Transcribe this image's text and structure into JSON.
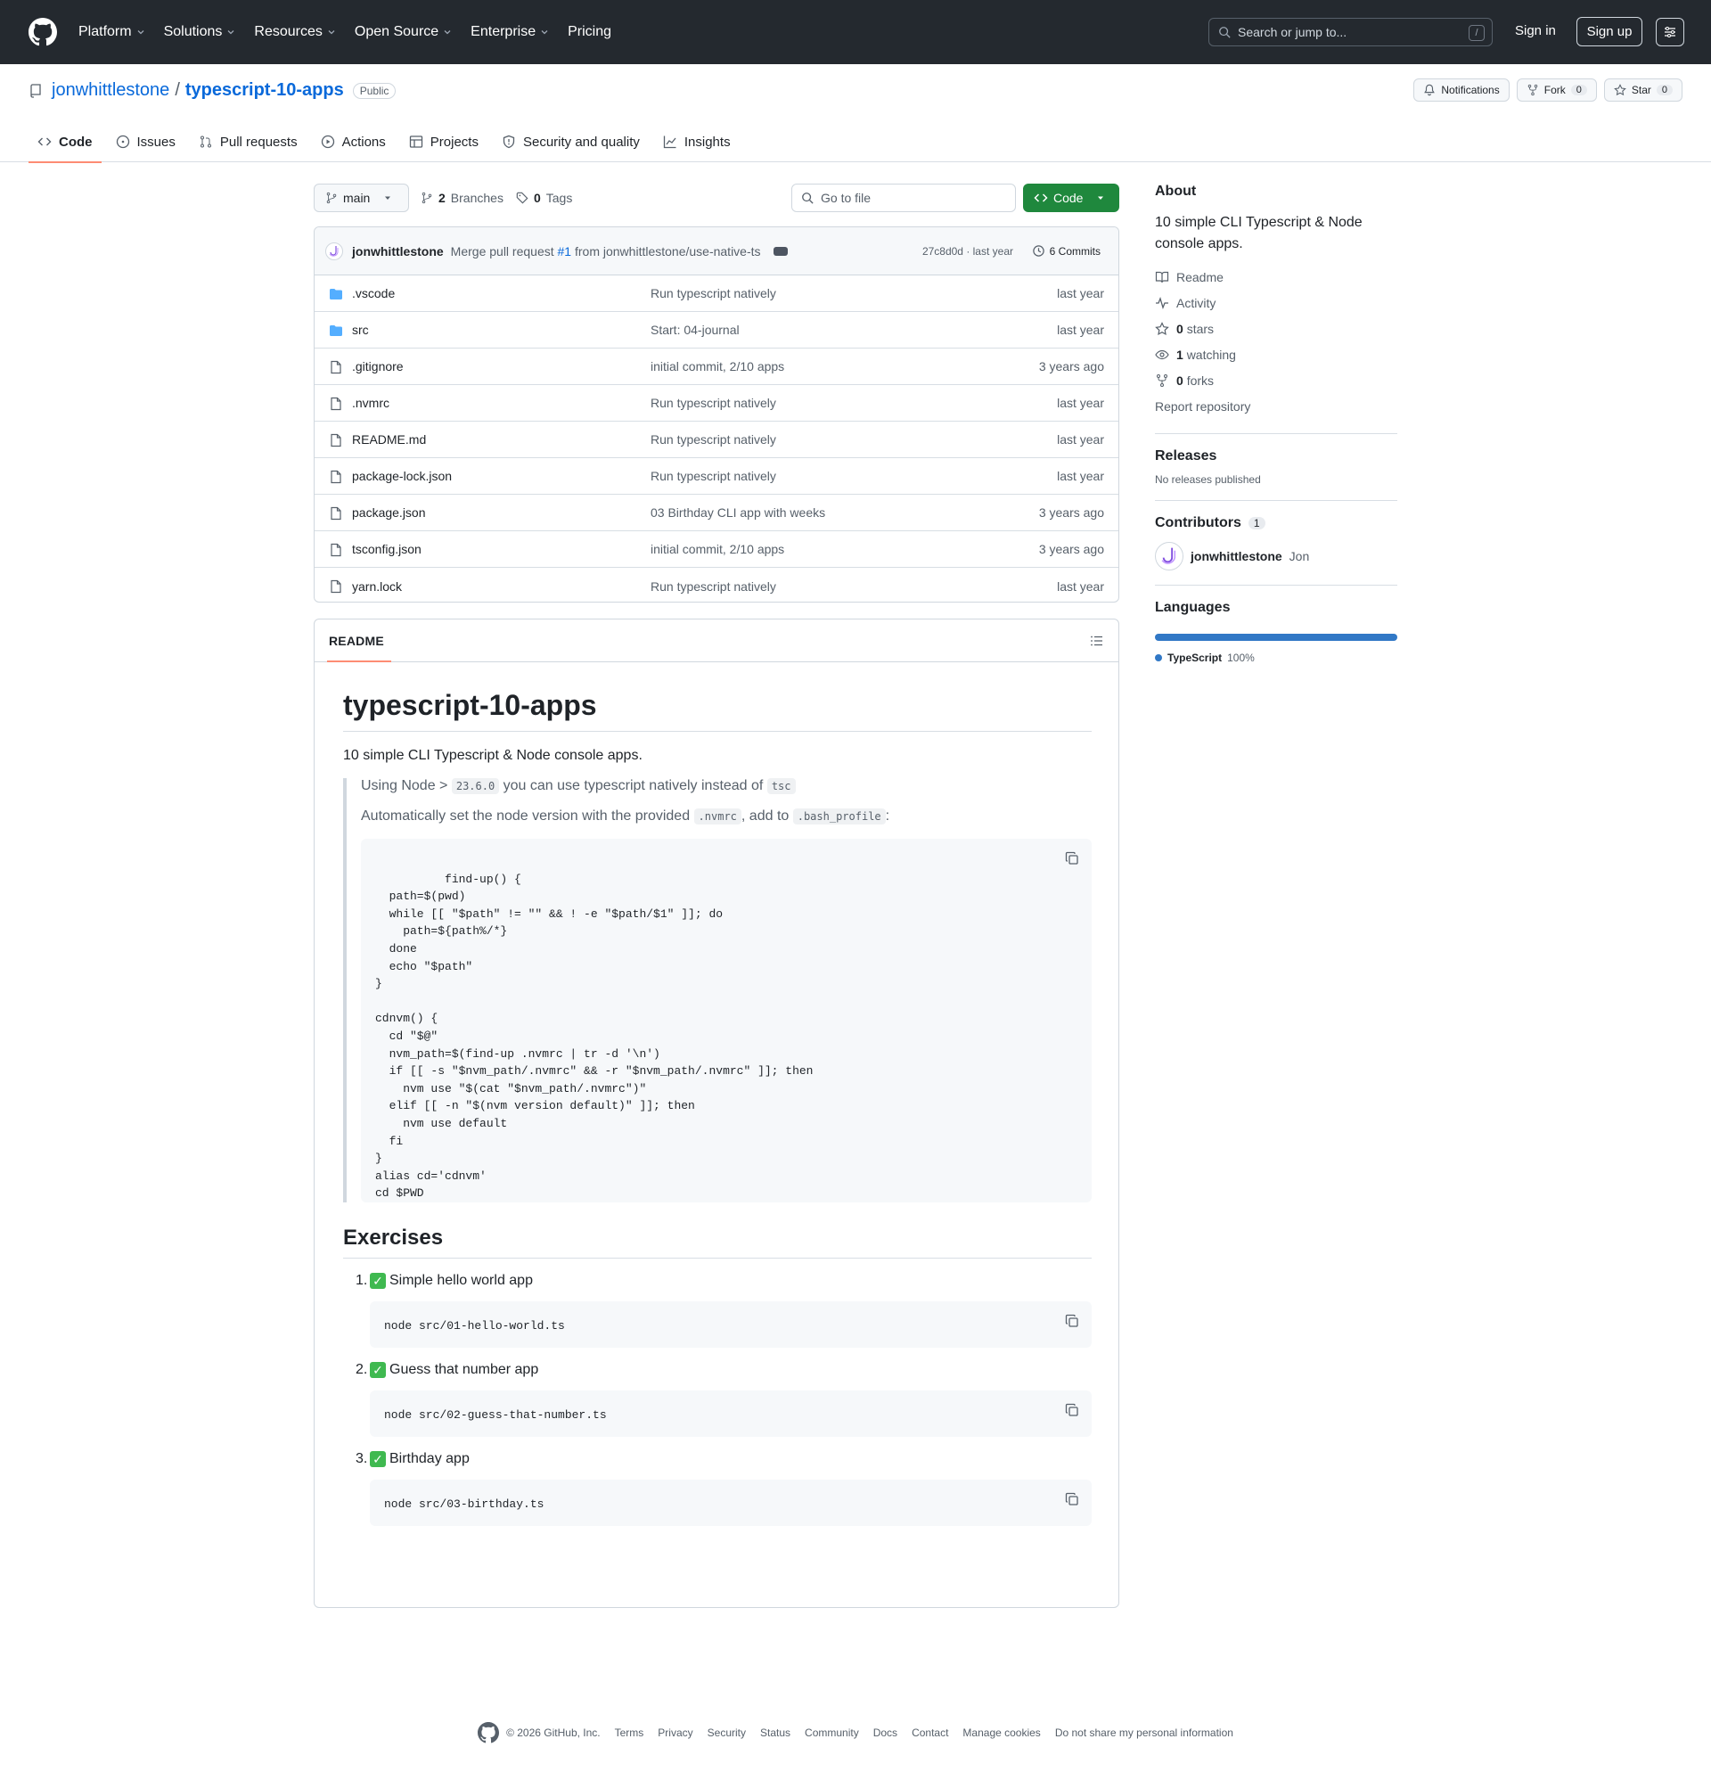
{
  "header": {
    "nav": [
      "Platform",
      "Solutions",
      "Resources",
      "Open Source",
      "Enterprise",
      "Pricing"
    ],
    "search_placeholder": "Search or jump to...",
    "search_shortcut": "/",
    "sign_in": "Sign in",
    "sign_up": "Sign up"
  },
  "repo": {
    "owner": "jonwhittlestone",
    "separator": "/",
    "name": "typescript-10-apps",
    "visibility": "Public",
    "actions": {
      "notifications": "Notifications",
      "fork": "Fork",
      "fork_count": "0",
      "star": "Star",
      "star_count": "0"
    },
    "tabs": [
      "Code",
      "Issues",
      "Pull requests",
      "Actions",
      "Projects",
      "Security and quality",
      "Insights"
    ]
  },
  "controls": {
    "branch": "main",
    "branches_count": "2",
    "branches_label": "Branches",
    "tags_count": "0",
    "tags_label": "Tags",
    "goto_placeholder": "Go to file",
    "code_button": "Code"
  },
  "commit": {
    "author": "jonwhittlestone",
    "message_pre": "Merge pull request",
    "pr_link": "#1",
    "message_post": "from jonwhittlestone/use-native-ts",
    "hash": "27c8d0d · last year",
    "commits": "6 Commits"
  },
  "files": [
    {
      "name": ".vscode",
      "type": "folder",
      "message": "Run typescript natively",
      "age": "last year"
    },
    {
      "name": "src",
      "type": "folder",
      "message": "Start: 04-journal",
      "age": "last year"
    },
    {
      "name": ".gitignore",
      "type": "file",
      "message": "initial commit, 2/10 apps",
      "age": "3 years ago"
    },
    {
      "name": ".nvmrc",
      "type": "file",
      "message": "Run typescript natively",
      "age": "last year"
    },
    {
      "name": "README.md",
      "type": "file",
      "message": "Run typescript natively",
      "age": "last year"
    },
    {
      "name": "package-lock.json",
      "type": "file",
      "message": "Run typescript natively",
      "age": "last year"
    },
    {
      "name": "package.json",
      "type": "file",
      "message": "03 Birthday CLI app with weeks",
      "age": "3 years ago"
    },
    {
      "name": "tsconfig.json",
      "type": "file",
      "message": "initial commit, 2/10 apps",
      "age": "3 years ago"
    },
    {
      "name": "yarn.lock",
      "type": "file",
      "message": "Run typescript natively",
      "age": "last year"
    }
  ],
  "readme": {
    "tab": "README",
    "title": "typescript-10-apps",
    "lead": "10 simple CLI Typescript & Node console apps.",
    "quote1_pre": "Using Node > ",
    "quote1_code1": "23.6.0",
    "quote1_mid": " you can use typescript natively instead of ",
    "quote1_code2": "tsc",
    "quote2_pre": "Automatically set the node version with the provided ",
    "quote2_code1": ".nvmrc",
    "quote2_mid": ", add to ",
    "quote2_code2": ".bash_profile",
    "quote2_post": ":",
    "script": "find-up() {\n  path=$(pwd)\n  while [[ \"$path\" != \"\" && ! -e \"$path/$1\" ]]; do\n    path=${path%/*}\n  done\n  echo \"$path\"\n}\n\ncdnvm() {\n  cd \"$@\"\n  nvm_path=$(find-up .nvmrc | tr -d '\\n')\n  if [[ -s \"$nvm_path/.nvmrc\" && -r \"$nvm_path/.nvmrc\" ]]; then\n    nvm use \"$(cat \"$nvm_path/.nvmrc\")\"\n  elif [[ -n \"$(nvm version default)\" ]]; then\n    nvm use default\n  fi\n}\nalias cd='cdnvm'\ncd $PWD",
    "exercises_heading": "Exercises",
    "exercises": [
      {
        "num": "1.",
        "title": "Simple hello world app",
        "cmd": "node src/01-hello-world.ts"
      },
      {
        "num": "2.",
        "title": "Guess that number app",
        "cmd": "node src/02-guess-that-number.ts"
      },
      {
        "num": "3.",
        "title": "Birthday app",
        "cmd": "node src/03-birthday.ts"
      }
    ]
  },
  "sidebar": {
    "about_heading": "About",
    "about_text": "10 simple CLI Typescript & Node console apps.",
    "readme": "Readme",
    "activity": "Activity",
    "stars_count": "0",
    "stars_label": "stars",
    "watching_count": "1",
    "watching_label": "watching",
    "forks_count": "0",
    "forks_label": "forks",
    "report": "Report repository",
    "releases_heading": "Releases",
    "releases_text": "No releases published",
    "contributors_heading": "Contributors",
    "contributors_count": "1",
    "contributor_login": "jonwhittlestone",
    "contributor_name": "Jon",
    "languages_heading": "Languages",
    "language_name": "TypeScript",
    "language_pct": "100%",
    "language_share": 1.0,
    "language_color": "#3178c6"
  },
  "footer": {
    "copyright": "© 2026 GitHub, Inc.",
    "links": [
      "Terms",
      "Privacy",
      "Security",
      "Status",
      "Community",
      "Docs",
      "Contact",
      "Manage cookies",
      "Do not share my personal information"
    ]
  },
  "colors": {
    "header_bg": "#24292f",
    "link": "#0969da",
    "code_button": "#1f883d",
    "tab_underline": "#fd8c73",
    "folder": "#54aeff"
  }
}
